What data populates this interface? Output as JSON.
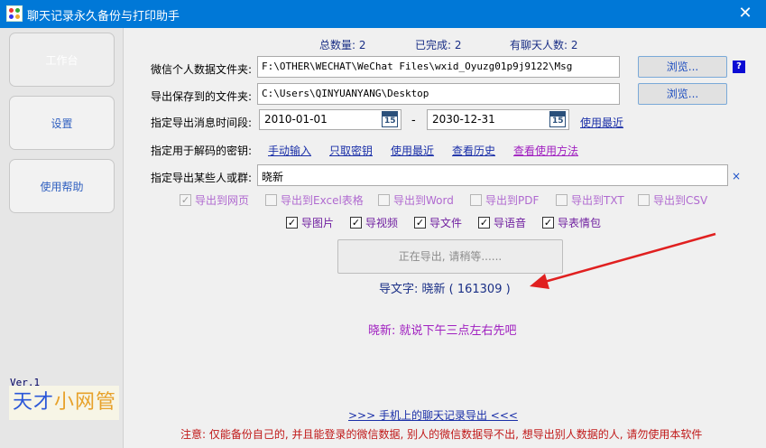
{
  "window": {
    "title": "聊天记录永久备份与打印助手",
    "close_glyph": "✕"
  },
  "sidebar": {
    "items": [
      {
        "label": "工作台"
      },
      {
        "label": "设置"
      },
      {
        "label": "使用帮助"
      }
    ],
    "version": "Ver.1",
    "logo": {
      "part1": "天才",
      "part2": "小网管"
    }
  },
  "stats": {
    "total": "总数量: 2",
    "done": "已完成: 2",
    "with_chat": "有聊天人数: 2"
  },
  "form": {
    "data_folder_label": "微信个人数据文件夹:",
    "data_folder_value": "F:\\OTHER\\WECHAT\\WeChat Files\\wxid_Oyuzg01p9j9122\\Msg",
    "browse1": "浏览...",
    "help_badge": "?",
    "save_folder_label": "导出保存到的文件夹:",
    "save_folder_value": "C:\\Users\\QINYUANYANG\\Desktop",
    "browse2": "浏览...",
    "date_label": "指定导出消息时间段:",
    "date_start": "2010-01-01",
    "date_end": "2030-12-31",
    "calendar_day": "15",
    "date_sep": "-",
    "date_recent_link": "使用最近",
    "key_label": "指定用于解码的密钥:",
    "key_links": {
      "manual": "手动输入",
      "read_only": "只取密钥",
      "recent": "使用最近",
      "history": "查看历史",
      "how": "查看使用方法"
    },
    "target_label": "指定导出某些人或群:",
    "target_value": "晓新",
    "clear_glyph": "×"
  },
  "export_formats": [
    {
      "label": "导出到网页",
      "checked": true
    },
    {
      "label": "导出到Excel表格",
      "checked": false
    },
    {
      "label": "导出到Word",
      "checked": false
    },
    {
      "label": "导出到PDF",
      "checked": false
    },
    {
      "label": "导出到TXT",
      "checked": false
    },
    {
      "label": "导出到CSV",
      "checked": false
    }
  ],
  "export_types": [
    {
      "label": "导图片",
      "checked": true
    },
    {
      "label": "导视频",
      "checked": true
    },
    {
      "label": "导文件",
      "checked": true
    },
    {
      "label": "导语音",
      "checked": true
    },
    {
      "label": "导表情包",
      "checked": true
    }
  ],
  "action": {
    "exporting_label": "正在导出, 请稍等......",
    "progress": "导文字: 晓新 ( 161309 )",
    "message": "晓新: 就说下午三点左右先吧"
  },
  "footer": {
    "mobile_link": ">>>  手机上的聊天记录导出  <<<",
    "notice": "注意: 仅能备份自己的, 并且能登录的微信数据, 别人的微信数据导不出, 想导出别人数据的人, 请勿使用本软件"
  },
  "colors": {
    "titlebar": "#0078d7",
    "arrow": "#e02020",
    "link": "#1a2fa8",
    "purple": "#a020c0"
  }
}
